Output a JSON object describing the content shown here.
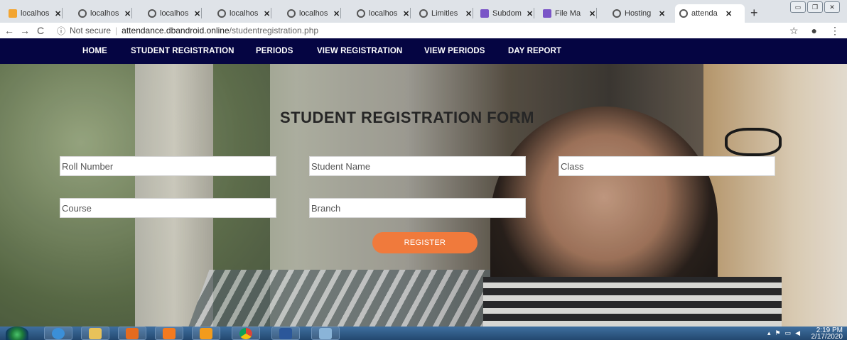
{
  "browser": {
    "tabs": [
      {
        "title": "localhos",
        "icon": "xampp-icon"
      },
      {
        "title": "localhos",
        "icon": "globe-icon"
      },
      {
        "title": "localhos",
        "icon": "globe-icon"
      },
      {
        "title": "localhos",
        "icon": "globe-icon"
      },
      {
        "title": "localhos",
        "icon": "globe-icon"
      },
      {
        "title": "localhos",
        "icon": "globe-icon"
      },
      {
        "title": "Limitles",
        "icon": "globe-icon"
      },
      {
        "title": "Subdom",
        "icon": "hostinger-icon"
      },
      {
        "title": "File Ma",
        "icon": "hostinger-icon"
      },
      {
        "title": "Hosting",
        "icon": "globe-icon"
      },
      {
        "title": "attenda",
        "icon": "globe-icon",
        "active": true
      }
    ],
    "new_tab": "+",
    "address": {
      "security": "Not secure",
      "host": "attendance.dbandroid.online",
      "path": "/studentregistration.php"
    }
  },
  "nav": {
    "items": [
      "HOME",
      "STUDENT REGISTRATION",
      "PERIODS",
      "VIEW REGISTRATION",
      "VIEW PERIODS",
      "DAY REPORT"
    ]
  },
  "form": {
    "title": "STUDENT REGISTRATION FORM",
    "fields": {
      "roll_number": "Roll Number",
      "student_name": "Student Name",
      "class": "Class",
      "course": "Course",
      "branch": "Branch"
    },
    "submit": "REGISTER"
  },
  "taskbar": {
    "clock_time": "2:19 PM",
    "clock_date": "2/17/2020"
  },
  "colors": {
    "nav_bg": "#050542",
    "button": "#f07a3c"
  }
}
